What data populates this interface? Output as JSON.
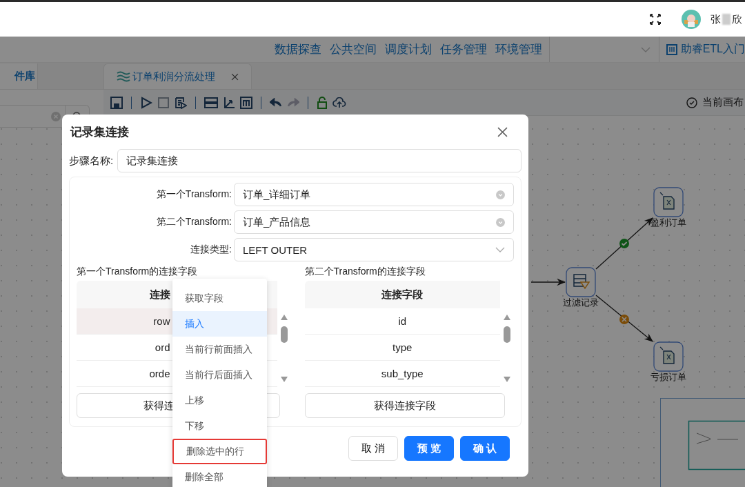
{
  "header": {
    "user": {
      "name_start": "张",
      "name_end": "欣"
    }
  },
  "nav": {
    "items": [
      "数据探查",
      "公共空间",
      "调度计划",
      "任务管理",
      "环境管理"
    ],
    "guide": "助睿ETL入门"
  },
  "side": {
    "tab": "件库"
  },
  "tabs": [
    {
      "label": "订单利润分流处理",
      "selected": true
    }
  ],
  "toolbar": {
    "status": "当前画布"
  },
  "canvas": {
    "nodes": [
      {
        "label": "过滤记录",
        "kind": "filter"
      },
      {
        "label": "盈利订单",
        "kind": "excel"
      },
      {
        "label": "亏损订单",
        "kind": "excel"
      }
    ]
  },
  "dialog": {
    "title": "记录集连接",
    "step_label": "步骤名称:",
    "step_name": "记录集连接",
    "fields": [
      {
        "label": "第一个Transform:",
        "value": "订单_详细订单",
        "kind": "clearable"
      },
      {
        "label": "第二个Transform:",
        "value": "订单_产品信息",
        "kind": "clearable"
      },
      {
        "label": "连接类型:",
        "value": "LEFT OUTER",
        "kind": "dropdown"
      }
    ],
    "tables": [
      {
        "title": "第一个Transform的连接字段",
        "header": "连接",
        "button": "获得连",
        "rows": [
          {
            "value": "row",
            "selected": true
          },
          {
            "value": "ord",
            "selected": false
          },
          {
            "value": "orde",
            "selected": false
          }
        ]
      },
      {
        "title": "第二个Transform的连接字段",
        "header": "连接字段",
        "button": "获得连接字段",
        "rows": [
          {
            "value": "id",
            "selected": false
          },
          {
            "value": "type",
            "selected": false
          },
          {
            "value": "sub_type",
            "selected": false
          }
        ]
      }
    ],
    "buttons": [
      {
        "label": "取 消",
        "kind": "default"
      },
      {
        "label": "预 览",
        "kind": "primary"
      },
      {
        "label": "确 认",
        "kind": "primary"
      }
    ]
  },
  "context_menu": {
    "items": [
      {
        "label": "获取字段",
        "selected": false,
        "highlighted": false
      },
      {
        "label": "插入",
        "selected": true,
        "highlighted": false
      },
      {
        "label": "当前行前面插入",
        "selected": false,
        "highlighted": false
      },
      {
        "label": "当前行后面插入",
        "selected": false,
        "highlighted": false
      },
      {
        "label": "上移",
        "selected": false,
        "highlighted": false
      },
      {
        "label": "下移",
        "selected": false,
        "highlighted": false
      },
      {
        "label": "删除选中的行",
        "selected": false,
        "highlighted": true
      },
      {
        "label": "删除全部",
        "selected": false,
        "highlighted": false
      }
    ]
  }
}
